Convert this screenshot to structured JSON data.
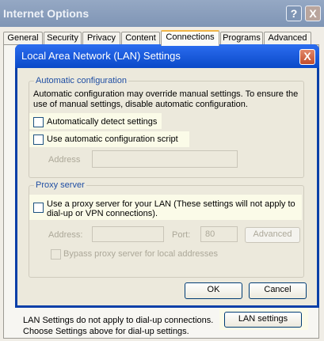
{
  "outer_window": {
    "title": "Internet Options",
    "help_label": "?",
    "close_label": "X",
    "tabs": [
      "General",
      "Security",
      "Privacy",
      "Content",
      "Connections",
      "Programs",
      "Advanced"
    ],
    "active_tab": "Connections",
    "lan_note_line1": "LAN Settings do not apply to dial-up connections.",
    "lan_note_line2": "Choose Settings above for dial-up settings.",
    "lan_settings_button": "LAN settings"
  },
  "dialog": {
    "title": "Local Area Network (LAN) Settings",
    "close_label": "X",
    "auto_config": {
      "group_label": "Automatic configuration",
      "description_line1": "Automatic configuration may override manual settings.  To ensure the",
      "description_line2": "use of manual settings, disable automatic configuration.",
      "auto_detect_label": "Automatically detect settings",
      "auto_detect_checked": false,
      "use_script_label": "Use automatic configuration script",
      "use_script_checked": false,
      "address_label": "Address",
      "address_value": ""
    },
    "proxy": {
      "group_label": "Proxy server",
      "use_proxy_line1": "Use a proxy server for your LAN (These settings will not apply to",
      "use_proxy_line2": "dial-up or VPN connections).",
      "use_proxy_checked": false,
      "address_label": "Address:",
      "address_value": "",
      "port_label": "Port:",
      "port_value": "80",
      "advanced_button": "Advanced",
      "bypass_label": "Bypass proxy server for local addresses",
      "bypass_checked": false
    },
    "ok_button": "OK",
    "cancel_button": "Cancel"
  },
  "colors": {
    "dialog_titlebar": "#0a49c8",
    "group_label": "#1f4ea3",
    "highlight": "#fbfbe8"
  }
}
